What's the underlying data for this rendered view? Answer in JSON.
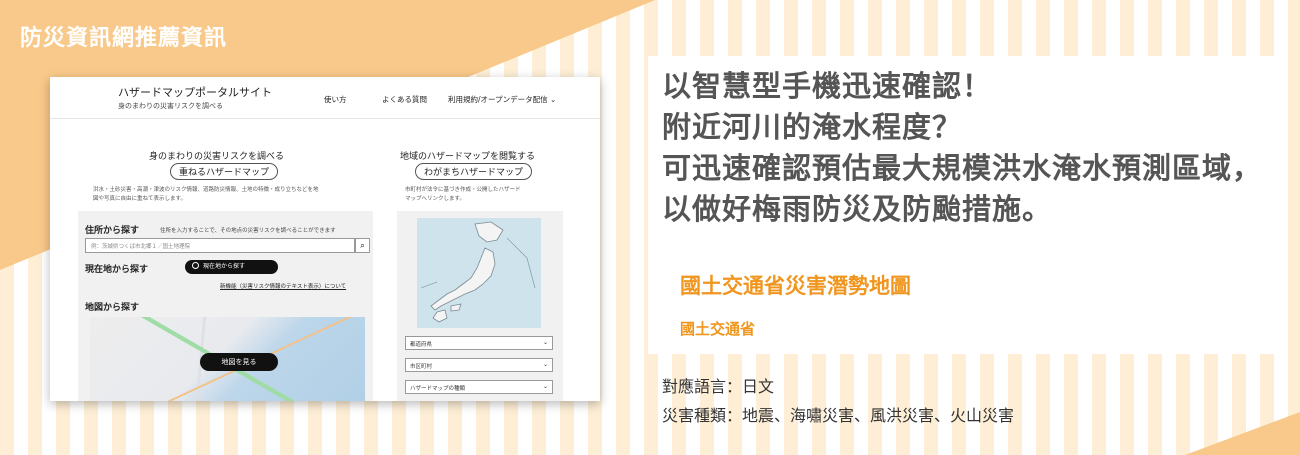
{
  "banner": {
    "title": "防災資訊網推薦資訊"
  },
  "headline": {
    "lines": [
      "以智慧型手機迅速確認！",
      "附近河川的淹水程度？",
      "可迅速確認預估最大規模洪水淹水預測區域，",
      "以做好梅雨防災及防颱措施。"
    ]
  },
  "site": {
    "name": "國土交通省災害潛勢地圖",
    "organization": "國土交通省"
  },
  "info": {
    "language": "對應語言：日文",
    "hazards": "災害種類：地震、海嘯災害、風洪災害、火山災害"
  },
  "screenshot": {
    "header": {
      "title": "ハザードマップポータルサイト",
      "subtitle": "身のまわりの災害リスクを調べる",
      "nav": [
        "使い方",
        "よくある質問",
        "利用規約/オープンデータ配信"
      ],
      "nav_chevron": "⌄"
    },
    "left": {
      "heading": "身のまわりの災害リスクを調べる",
      "pill": "重ねるハザードマップ",
      "desc": [
        "洪水・土砂災害・高潮・津波のリスク情報、道路防災情報、土地の特徴・成り立ちなどを地",
        "図や写真に自由に重ねて表示します。"
      ],
      "address_label": "住所から探す",
      "address_note": "住所を入力することで、その地点の災害リスクを調べることができます",
      "address_placeholder": "例：茨城県つくば市北郷１／国土地理院",
      "search_glyph": "⌕",
      "current_label": "現在地から探す",
      "current_button": "現在地から探す",
      "text_link": "新機能（災害リスク情報のテキスト表示）について",
      "map_label": "地図から探す",
      "map_button": "地図を見る"
    },
    "right": {
      "heading": "地域のハザードマップを閲覧する",
      "pill": "わがまちハザードマップ",
      "desc": [
        "市町村が法令に基づき作成・公開したハザード",
        "マップへリンクします。"
      ],
      "selects": [
        "都道府県",
        "市区町村",
        "ハザードマップの種類"
      ],
      "select_caret": "⌄"
    }
  },
  "colors": {
    "accent": "#f0961e",
    "banner_bg": "#f8c98a",
    "stripe": "#fdeed5",
    "headline": "#555555"
  }
}
